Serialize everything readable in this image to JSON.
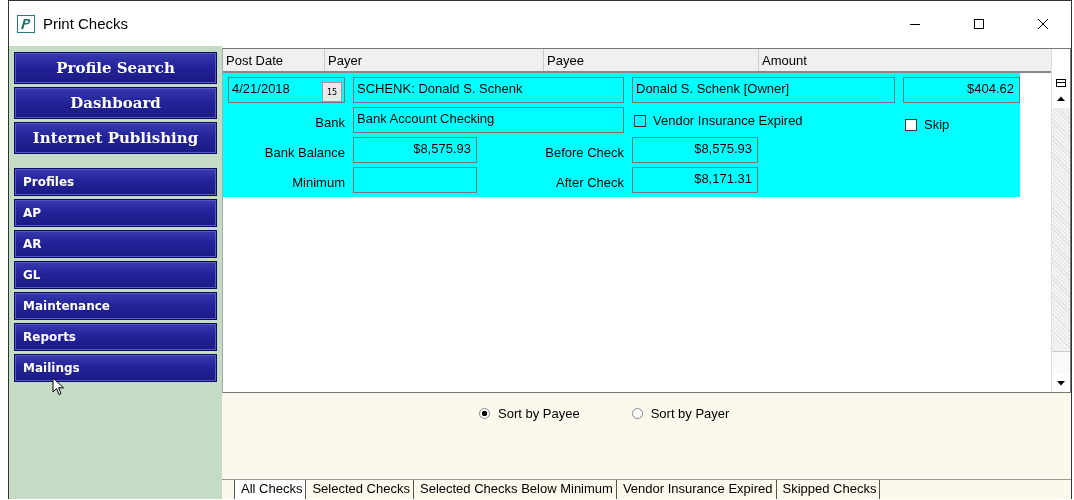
{
  "window": {
    "title": "Print Checks"
  },
  "sidebar": {
    "main_buttons": [
      "Profile Search",
      "Dashboard",
      "Internet Publishing"
    ],
    "modules": [
      "Profiles",
      "AP",
      "AR",
      "GL",
      "Maintenance",
      "Reports",
      "Mailings"
    ]
  },
  "table": {
    "columns": [
      "Post Date",
      "Payer",
      "Payee",
      "Amount"
    ],
    "rows": [
      {
        "selected": true,
        "post_date": "4/21/2018",
        "calendar_day": "15",
        "payer": "SCHENK: Donald S. Schenk",
        "payee": "Donald S. Schenk  [Owner]",
        "amount": "$404.62",
        "bank_label": "Bank",
        "bank": "Bank Account Checking",
        "vendor_insurance_expired": {
          "label": "Vendor Insurance Expired",
          "checked": false
        },
        "skip": {
          "label": "Skip",
          "checked": false
        },
        "bank_balance_label": "Bank Balance",
        "bank_balance": "$8,575.93",
        "before_check_label": "Before Check",
        "before_check": "$8,575.93",
        "minimum_label": "Minimum",
        "after_check_label": "After Check",
        "after_check": "$8,171.31"
      }
    ]
  },
  "sort_options": [
    {
      "label": "Sort by Payee",
      "selected": true
    },
    {
      "label": "Sort by Payer",
      "selected": false
    }
  ],
  "tabs": [
    {
      "label": "All Checks",
      "selected": true
    },
    {
      "label": "Selected Checks",
      "selected": false
    },
    {
      "label": "Selected Checks Below Minimum",
      "selected": false
    },
    {
      "label": "Vendor Insurance Expired",
      "selected": false
    },
    {
      "label": "Skipped Checks",
      "selected": false
    }
  ]
}
